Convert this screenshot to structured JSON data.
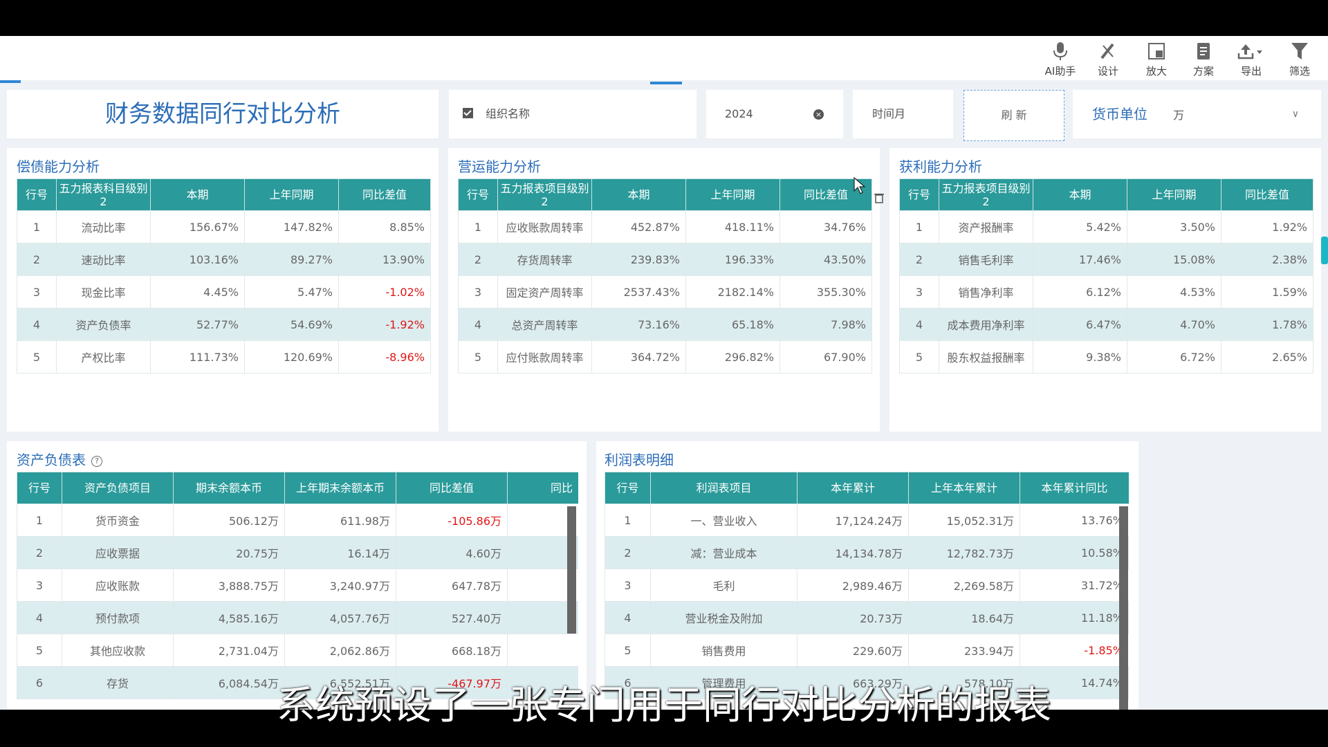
{
  "toolbar": {
    "items": [
      {
        "label": "AI助手",
        "icon": "microphone-icon"
      },
      {
        "label": "设计",
        "icon": "design-tools-icon"
      },
      {
        "label": "放大",
        "icon": "enlarge-icon"
      },
      {
        "label": "方案",
        "icon": "document-icon"
      },
      {
        "label": "导出",
        "icon": "export-icon"
      },
      {
        "label": "筛选",
        "icon": "funnel-icon"
      }
    ]
  },
  "page_title": "财务数据同行对比分析",
  "filters": {
    "org_name_label": "组织名称",
    "year_value": "2024",
    "month_placeholder": "时间月",
    "refresh_label": "刷 新",
    "currency_label": "货币单位",
    "currency_value": "万"
  },
  "solvency": {
    "title": "偿债能力分析",
    "headers": [
      "行号",
      "五力报表科目级别2",
      "本期",
      "上年同期",
      "同比差值"
    ],
    "rows": [
      [
        "1",
        "流动比率",
        "156.67%",
        "147.82%",
        "8.85%"
      ],
      [
        "2",
        "速动比率",
        "103.16%",
        "89.27%",
        "13.90%"
      ],
      [
        "3",
        "现金比率",
        "4.45%",
        "5.47%",
        "-1.02%"
      ],
      [
        "4",
        "资产负债率",
        "52.77%",
        "54.69%",
        "-1.92%"
      ],
      [
        "5",
        "产权比率",
        "111.73%",
        "120.69%",
        "-8.96%"
      ]
    ]
  },
  "operation": {
    "title": "营运能力分析",
    "headers": [
      "行号",
      "五力报表项目级别2",
      "本期",
      "上年同期",
      "同比差值"
    ],
    "rows": [
      [
        "1",
        "应收账款周转率",
        "452.87%",
        "418.11%",
        "34.76%"
      ],
      [
        "2",
        "存货周转率",
        "239.83%",
        "196.33%",
        "43.50%"
      ],
      [
        "3",
        "固定资产周转率",
        "2537.43%",
        "2182.14%",
        "355.30%"
      ],
      [
        "4",
        "总资产周转率",
        "73.16%",
        "65.18%",
        "7.98%"
      ],
      [
        "5",
        "应付账款周转率",
        "364.72%",
        "296.82%",
        "67.90%"
      ]
    ]
  },
  "profit": {
    "title": "获利能力分析",
    "headers": [
      "行号",
      "五力报表项目级别2",
      "本期",
      "上年同期",
      "同比差值"
    ],
    "rows": [
      [
        "1",
        "资产报酬率",
        "5.42%",
        "3.50%",
        "1.92%"
      ],
      [
        "2",
        "销售毛利率",
        "17.46%",
        "15.08%",
        "2.38%"
      ],
      [
        "3",
        "销售净利率",
        "6.12%",
        "4.53%",
        "1.59%"
      ],
      [
        "4",
        "成本费用净利率",
        "6.47%",
        "4.70%",
        "1.78%"
      ],
      [
        "5",
        "股东权益报酬率",
        "9.38%",
        "6.72%",
        "2.65%"
      ]
    ]
  },
  "balance": {
    "title": "资产负债表",
    "headers": [
      "行号",
      "资产负债项目",
      "期末余额本币",
      "上年期末余额本币",
      "同比差值",
      "同比"
    ],
    "rows": [
      [
        "1",
        "货币资金",
        "506.12万",
        "611.98万",
        "-105.86万",
        ""
      ],
      [
        "2",
        "应收票据",
        "20.75万",
        "16.14万",
        "4.60万",
        ""
      ],
      [
        "3",
        "应收账款",
        "3,888.75万",
        "3,240.97万",
        "647.78万",
        ""
      ],
      [
        "4",
        "预付款项",
        "4,585.16万",
        "4,057.76万",
        "527.40万",
        ""
      ],
      [
        "5",
        "其他应收款",
        "2,731.04万",
        "2,062.86万",
        "668.18万",
        ""
      ],
      [
        "6",
        "存货",
        "6,084.54万",
        "6,552.51万",
        "-467.97万",
        ""
      ]
    ]
  },
  "income": {
    "title": "利润表明细",
    "headers": [
      "行号",
      "利润表项目",
      "本年累计",
      "上年本年累计",
      "本年累计同比"
    ],
    "rows": [
      [
        "1",
        "一、营业收入",
        "17,124.24万",
        "15,052.31万",
        "13.76%"
      ],
      [
        "2",
        "减：营业成本",
        "14,134.78万",
        "12,782.73万",
        "10.58%"
      ],
      [
        "3",
        "毛利",
        "2,989.46万",
        "2,269.58万",
        "31.72%"
      ],
      [
        "4",
        "营业税金及附加",
        "20.73万",
        "18.64万",
        "11.18%"
      ],
      [
        "5",
        "销售费用",
        "229.60万",
        "233.94万",
        "-1.85%"
      ],
      [
        "6",
        "管理费用",
        "663.29万",
        "578.10万",
        "14.74%"
      ]
    ]
  },
  "subtitle": "系统预设了一张专门用于同行对比分析的报表",
  "colors": {
    "header_teal": "#2a9a9a",
    "title_blue": "#2c6db8",
    "negative_red": "#e01616",
    "alt_row": "#dcedf0"
  }
}
